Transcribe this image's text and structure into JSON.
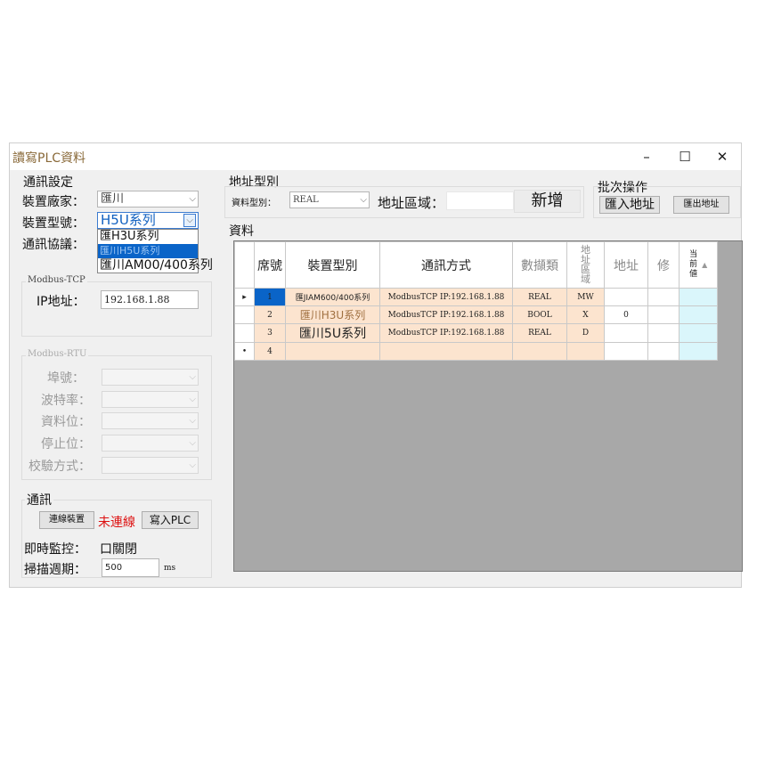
{
  "window": {
    "title": "讀寫PLC資料",
    "controls": {
      "minimize": "–",
      "maximize": "☐",
      "close": "✕"
    }
  },
  "comm_settings": {
    "group_title": "通訊設定",
    "vendor_label": "裝置廠家：",
    "vendor_value": "匯川",
    "model_label": "裝置型號：",
    "model_value": "H5U系列",
    "protocol_label": "通訊協議：",
    "model_dropdown_options": [
      "匯H3U系列",
      "匯川H5U系列",
      "匯川AM00/400系列"
    ],
    "model_dropdown_selected_index": 1
  },
  "modbus_tcp": {
    "legend": "Modbus-TCP",
    "ip_label": "IP地址：",
    "ip_value": "192.168.1.88"
  },
  "modbus_rtu": {
    "legend": "Modbus-RTU",
    "port_label": "埠號：",
    "baud_label": "波特率：",
    "databits_label": "資料位：",
    "stopbits_label": "停止位：",
    "parity_label": "校驗方式："
  },
  "comm": {
    "group_title": "通訊",
    "connect_button": "連線裝置",
    "status_text": "未連線",
    "status_color": "#d11111",
    "write_button": "寫入PLC",
    "monitor_label": "即時監控：",
    "monitor_value": "口關閉",
    "scan_label": "掃描週期：",
    "scan_value": "500",
    "scan_unit": "ms"
  },
  "address_type": {
    "group_title": "地址型別",
    "data_type_label": "資料型別：",
    "data_type_value": "REAL",
    "area_label": "地址區域：",
    "add_button": "新增"
  },
  "batch": {
    "group_title": "批次操作",
    "import_button": "匯入地址",
    "export_button": "匯出地址"
  },
  "data_grid": {
    "section_title": "資料",
    "columns": [
      "席號",
      "裝置型別",
      "通訊方式",
      "數擷類",
      "地址區域",
      "地址",
      "修",
      "当前値"
    ],
    "sort_icon": "▲",
    "rows": [
      {
        "marker": "▸",
        "seq": "1",
        "device": "匯JIAM600/400系列",
        "comm": "ModbusTCP IP:192.168.1.88",
        "dtype": "REAL",
        "area": "MW",
        "addr": "",
        "mod": "",
        "value": ""
      },
      {
        "marker": "",
        "seq": "2",
        "device": "匯川H3U系列",
        "comm": "ModbusTCP IP:192.168.1.88",
        "dtype": "BOOL",
        "area": "X",
        "addr": "0",
        "mod": "",
        "value": ""
      },
      {
        "marker": "",
        "seq": "3",
        "device": "匯川5U系列",
        "comm": "ModbusTCP IP:192.168.1.88",
        "dtype": "REAL",
        "area": "D",
        "addr": "",
        "mod": "",
        "value": ""
      },
      {
        "marker": "•",
        "seq": "4",
        "device": "",
        "comm": "",
        "dtype": "",
        "area": "",
        "addr": "",
        "mod": "",
        "value": ""
      }
    ]
  },
  "icons": {
    "combo_arrow": "chevron-down-icon",
    "row_pointer": "row-pointer-icon"
  }
}
